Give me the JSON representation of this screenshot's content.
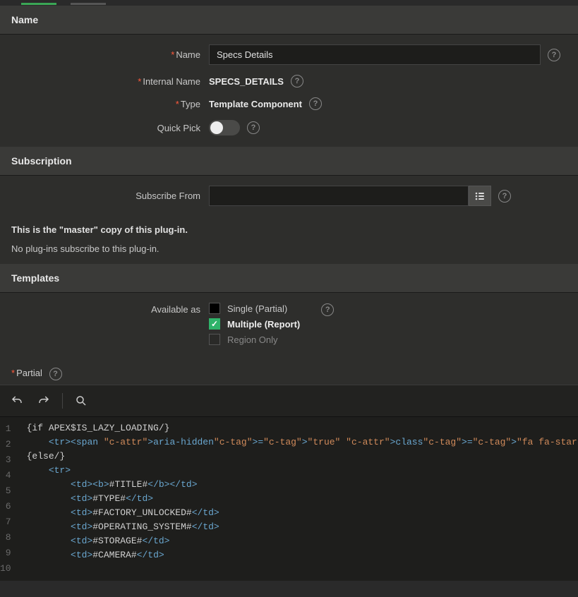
{
  "sections": {
    "name_header": "Name",
    "subscription_header": "Subscription",
    "templates_header": "Templates"
  },
  "name": {
    "name_label": "Name",
    "name_value": "Specs Details",
    "internal_label": "Internal Name",
    "internal_value": "SPECS_DETAILS",
    "type_label": "Type",
    "type_value": "Template Component",
    "quickpick_label": "Quick Pick"
  },
  "subscription": {
    "subscribe_from_label": "Subscribe From",
    "subscribe_from_value": "",
    "msg1": "This is the \"master\" copy of this plug-in.",
    "msg2": "No plug-ins subscribe to this plug-in."
  },
  "templates": {
    "available_label": "Available as",
    "opt_single": "Single (Partial)",
    "opt_multiple": "Multiple (Report)",
    "opt_region": "Region Only",
    "partial_label": "Partial"
  },
  "code": {
    "lines": [
      "{if APEX$IS_LAZY_LOADING/}",
      "    <tr><span aria-hidden=\"true\" class=\"fa fa-star-o fa-anim-spin\"></span></tr>",
      "{else/}",
      "    <tr>",
      "        <td><b>#TITLE#</b></td>",
      "        <td>#TYPE#</td>",
      "        <td>#FACTORY_UNLOCKED#</td>",
      "        <td>#OPERATING_SYSTEM#</td>",
      "        <td>#STORAGE#</td>",
      "        <td>#CAMERA#</td>"
    ]
  }
}
